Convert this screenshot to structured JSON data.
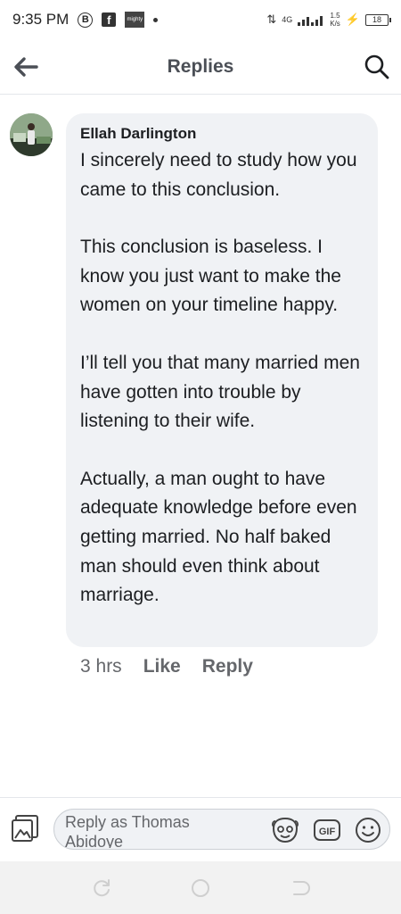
{
  "status_bar": {
    "time": "9:35 PM",
    "network": "4G",
    "speed_value": "1.5",
    "speed_unit": "K/s",
    "battery": "18"
  },
  "header": {
    "title": "Replies"
  },
  "comment": {
    "author": "Ellah Darlington",
    "paragraphs": [
      "I sincerely need to study how you came to this conclusion.",
      "This conclusion is baseless. I know you just want to make the women on your timeline happy.",
      "I’ll tell you that many married men have gotten into trouble by listening to their wife.",
      "Actually, a man ought to have adequate knowledge before even getting married. No half baked man should even think about marriage."
    ],
    "time": "3 hrs",
    "like_label": "Like",
    "reply_label": "Reply"
  },
  "reply_bar": {
    "placeholder": "Reply as Thomas Abidoye"
  },
  "colors": {
    "bubble_bg": "#f0f2f5",
    "secondary_text": "#65676b",
    "title_text": "#4b4f56"
  },
  "icons": {
    "back": "arrow-left-icon",
    "search": "magnifier-icon",
    "photo": "photo-icon",
    "sticker": "sticker-face-icon",
    "gif": "gif-icon",
    "emoji": "smiley-icon"
  }
}
